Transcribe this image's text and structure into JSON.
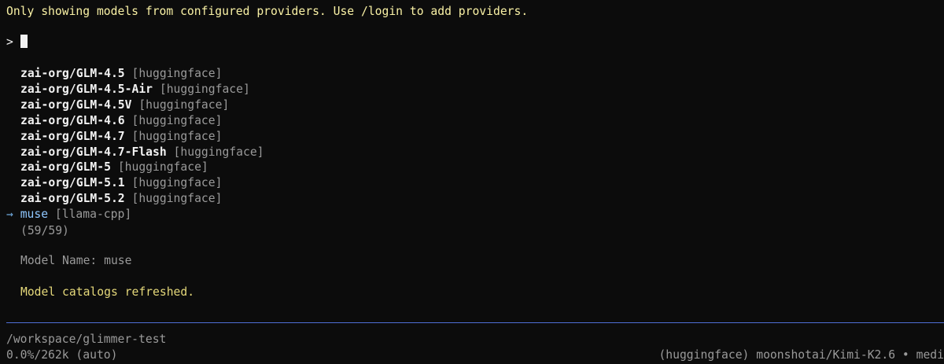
{
  "notice": "Only showing models from configured providers. Use /login to add providers.",
  "prompt": {
    "symbol": ">",
    "input_value": ""
  },
  "models": [
    {
      "name": "zai-org/GLM-4.5",
      "provider": "[huggingface]"
    },
    {
      "name": "zai-org/GLM-4.5-Air",
      "provider": "[huggingface]"
    },
    {
      "name": "zai-org/GLM-4.5V",
      "provider": "[huggingface]"
    },
    {
      "name": "zai-org/GLM-4.6",
      "provider": "[huggingface]"
    },
    {
      "name": "zai-org/GLM-4.7",
      "provider": "[huggingface]"
    },
    {
      "name": "zai-org/GLM-4.7-Flash",
      "provider": "[huggingface]"
    },
    {
      "name": "zai-org/GLM-5",
      "provider": "[huggingface]"
    },
    {
      "name": "zai-org/GLM-5.1",
      "provider": "[huggingface]"
    },
    {
      "name": "zai-org/GLM-5.2",
      "provider": "[huggingface]"
    }
  ],
  "selected": {
    "arrow": "→",
    "name": "muse",
    "provider": "[llama-cpp]"
  },
  "count": "(59/59)",
  "model_name_line": "Model Name: muse",
  "status_message": "Model catalogs refreshed.",
  "footer": {
    "cwd": "/workspace/glimmer-test",
    "context_usage": "0.0%/262k (auto)",
    "active_model": "(huggingface) moonshotai/Kimi-K2.6 • medi"
  },
  "colors": {
    "background": "#0c0c0c",
    "notice": "#f9f1a5",
    "selected": "#8fc7ff",
    "success": "#e5d87a",
    "divider": "#4f6fd6"
  }
}
